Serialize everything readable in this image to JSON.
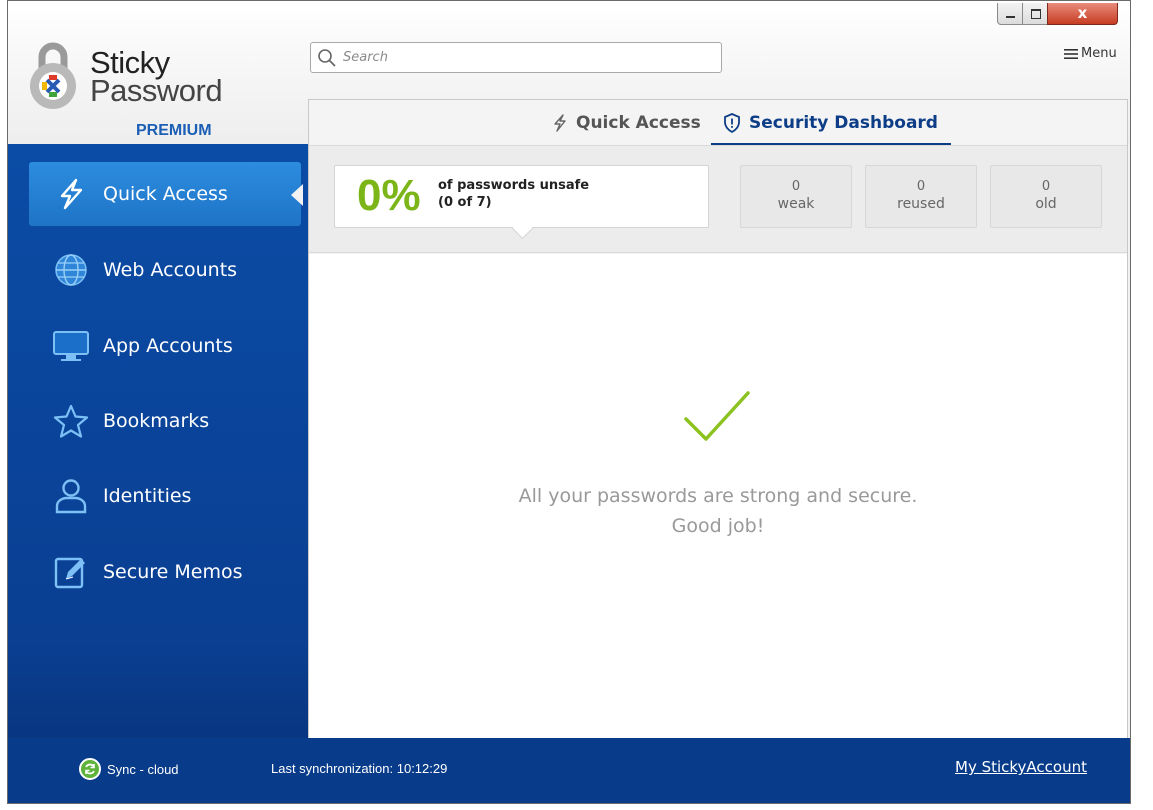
{
  "app": {
    "logo_line1": "Sticky",
    "logo_line2": "Password",
    "logo_line3": "PREMIUM"
  },
  "search": {
    "placeholder": "Search"
  },
  "window_controls": {
    "close_label": "x"
  },
  "menu": {
    "label": "Menu"
  },
  "sidebar": {
    "items": [
      {
        "label": "Quick Access",
        "icon": "lightning-icon",
        "active": true
      },
      {
        "label": "Web Accounts",
        "icon": "globe-icon"
      },
      {
        "label": "App Accounts",
        "icon": "monitor-icon"
      },
      {
        "label": "Bookmarks",
        "icon": "star-icon"
      },
      {
        "label": "Identities",
        "icon": "person-icon"
      },
      {
        "label": "Secure Memos",
        "icon": "memo-edit-icon"
      }
    ]
  },
  "tabs": {
    "quick_access": "Quick Access",
    "security_dashboard": "Security Dashboard",
    "active": "security_dashboard"
  },
  "dashboard": {
    "unsafe_percent": "0%",
    "unsafe_label": "of passwords unsafe",
    "unsafe_count": "(0 of 7)",
    "stats": [
      {
        "value": "0",
        "name": "weak"
      },
      {
        "value": "0",
        "name": "reused"
      },
      {
        "value": "0",
        "name": "old"
      }
    ],
    "message_line1": "All your passwords are strong and secure.",
    "message_line2": "Good job!"
  },
  "footer": {
    "sync_label": "Sync - cloud",
    "last_sync": "Last synchronization: 10:12:29",
    "account_link": "My StickyAccount"
  },
  "colors": {
    "sidebar": "#0b4ca6",
    "active_item": "#2c8cde",
    "accent_green": "#7cb518",
    "tab_active": "#0d3d87"
  }
}
